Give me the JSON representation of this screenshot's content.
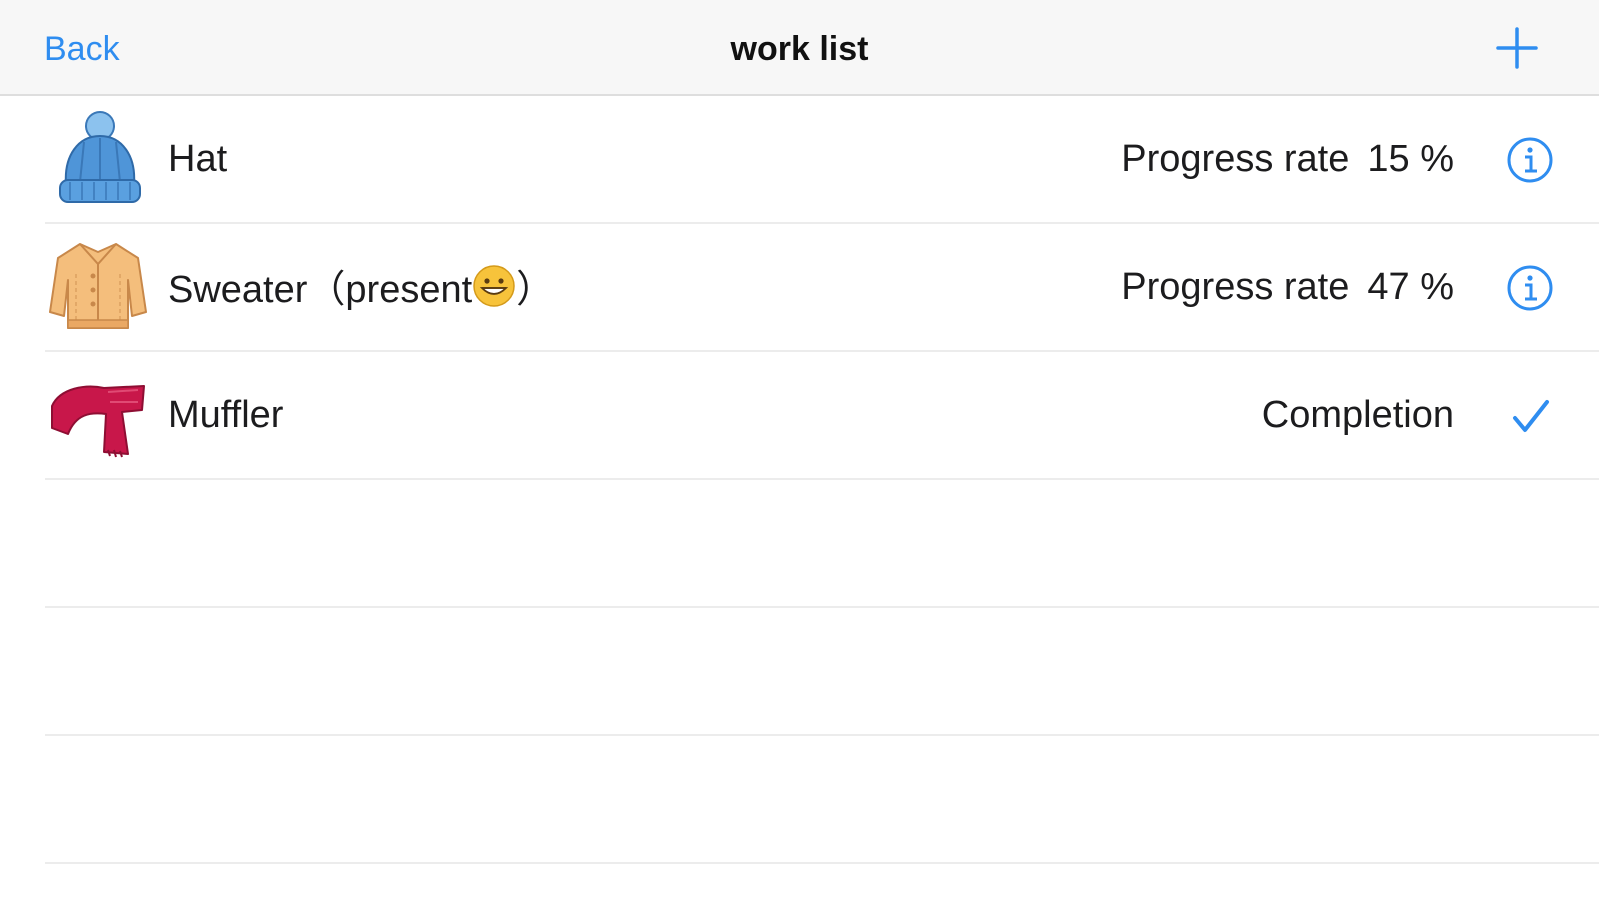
{
  "navbar": {
    "back_label": "Back",
    "title": "work list",
    "add_icon": "plus-icon"
  },
  "items": [
    {
      "icon": "knit-hat-icon",
      "name": "Hat",
      "status_label": "Progress rate",
      "progress": "15 %",
      "accessory": "info-icon"
    },
    {
      "icon": "sweater-icon",
      "name_prefix": "Sweater（present",
      "name_emoji": "grinning-face-emoji",
      "name_suffix": "）",
      "status_label": "Progress rate",
      "progress": "47 %",
      "accessory": "info-icon"
    },
    {
      "icon": "muffler-icon",
      "name": "Muffler",
      "status_label": "Completion",
      "accessory": "checkmark-icon"
    }
  ],
  "colors": {
    "accent": "#2f8df0",
    "navbar_bg": "#f7f7f7",
    "separator": "#ececec",
    "hat": "#4f95d8",
    "sweater": "#f4be7c",
    "muffler": "#c8174a"
  }
}
